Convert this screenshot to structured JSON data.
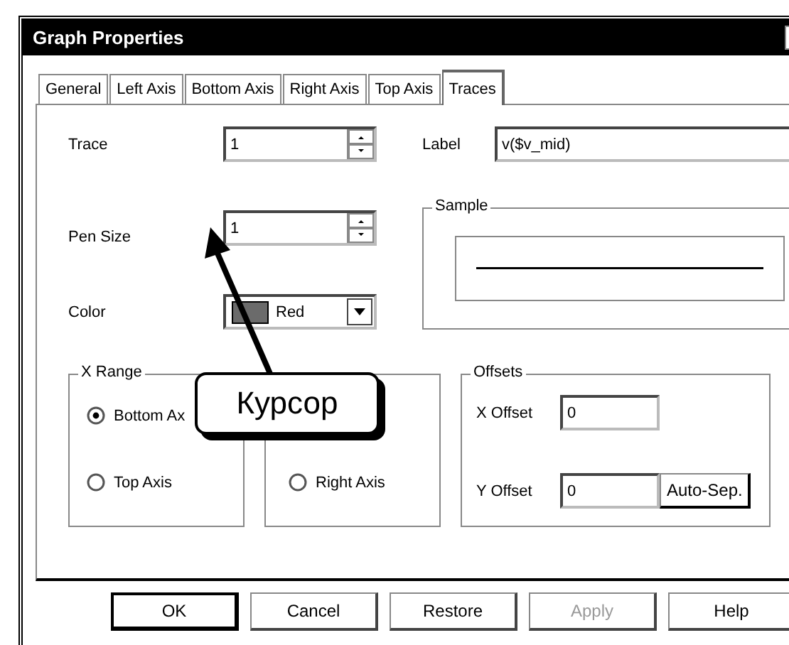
{
  "window": {
    "title": "Graph Properties"
  },
  "tabs": [
    {
      "label": "General",
      "selected": false
    },
    {
      "label": "Left Axis",
      "selected": false
    },
    {
      "label": "Bottom Axis",
      "selected": false
    },
    {
      "label": "Right Axis",
      "selected": false
    },
    {
      "label": "Top Axis",
      "selected": false
    },
    {
      "label": "Traces",
      "selected": true
    }
  ],
  "trace": {
    "label": "Trace",
    "value": "1"
  },
  "label_field": {
    "label": "Label",
    "value": "v($v_mid)"
  },
  "pen_size": {
    "label": "Pen Size",
    "value": "1"
  },
  "color": {
    "label": "Color",
    "value": "Red"
  },
  "sample": {
    "title": "Sample"
  },
  "x_range": {
    "title": "X Range",
    "options": [
      {
        "label": "Bottom Ax",
        "selected": true
      },
      {
        "label": "Top Axis",
        "selected": false
      }
    ]
  },
  "y_range": {
    "options": [
      {
        "label": "Right Axis",
        "selected": false
      }
    ]
  },
  "offsets": {
    "title": "Offsets",
    "x_offset": {
      "label": "X Offset",
      "value": "0"
    },
    "y_offset": {
      "label": "Y Offset",
      "value": "0"
    },
    "auto_button": "Auto-Sep."
  },
  "buttons": [
    {
      "label": "OK",
      "default": true,
      "disabled": false
    },
    {
      "label": "Cancel",
      "default": false,
      "disabled": false
    },
    {
      "label": "Restore",
      "default": false,
      "disabled": false
    },
    {
      "label": "Apply",
      "default": false,
      "disabled": true
    },
    {
      "label": "Help",
      "default": false,
      "disabled": false
    }
  ],
  "callout": {
    "text": "Курсор"
  }
}
